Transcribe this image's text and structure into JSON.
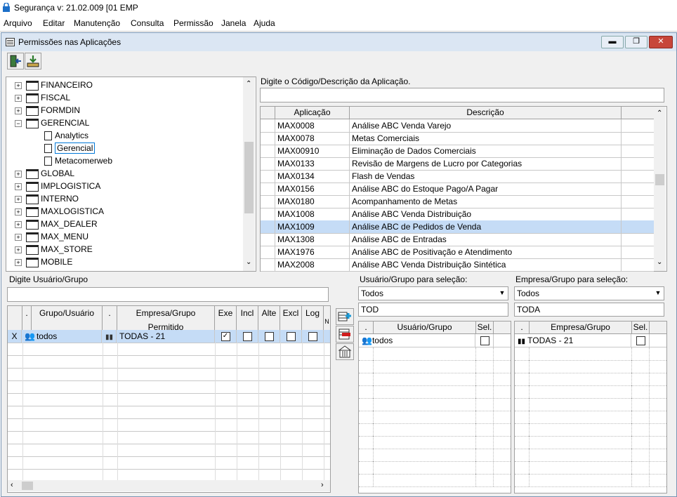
{
  "app": {
    "title": "Segurança  v: 21.02.009  [01 EMP"
  },
  "menu": [
    "Arquivo",
    "Editar",
    "Manutenção",
    "Consulta",
    "Permissão",
    "Janela",
    "Ajuda"
  ],
  "window": {
    "title": "Permissões nas Aplicações"
  },
  "tree": {
    "items": [
      {
        "label": "FINANCEIRO",
        "type": "folder",
        "expanded": false
      },
      {
        "label": "FISCAL",
        "type": "folder",
        "expanded": false
      },
      {
        "label": "FORMDIN",
        "type": "folder",
        "expanded": false
      },
      {
        "label": "GERENCIAL",
        "type": "folder",
        "expanded": true
      },
      {
        "label": "Analytics",
        "type": "doc"
      },
      {
        "label": "Gerencial",
        "type": "doc",
        "selected": true
      },
      {
        "label": "Metacomerweb",
        "type": "doc"
      },
      {
        "label": "GLOBAL",
        "type": "folder",
        "expanded": false
      },
      {
        "label": "IMPLOGISTICA",
        "type": "folder",
        "expanded": false
      },
      {
        "label": "INTERNO",
        "type": "folder",
        "expanded": false
      },
      {
        "label": "MAXLOGISTICA",
        "type": "folder",
        "expanded": false
      },
      {
        "label": "MAX_DEALER",
        "type": "folder",
        "expanded": false
      },
      {
        "label": "MAX_MENU",
        "type": "folder",
        "expanded": false
      },
      {
        "label": "MAX_STORE",
        "type": "folder",
        "expanded": false
      },
      {
        "label": "MOBILE",
        "type": "folder",
        "expanded": false
      }
    ]
  },
  "app_search": {
    "label": "Digite o Código/Descrição da Aplicação.",
    "value": ""
  },
  "app_grid": {
    "headers": [
      "Aplicação",
      "Descrição"
    ],
    "rows": [
      [
        "MAX0008",
        "Análise ABC Venda Varejo"
      ],
      [
        "MAX0078",
        "Metas Comerciais"
      ],
      [
        "MAX00910",
        "Eliminação de Dados Comerciais"
      ],
      [
        "MAX0133",
        "Revisão de Margens de Lucro por Categorias"
      ],
      [
        "MAX0134",
        "Flash de Vendas"
      ],
      [
        "MAX0156",
        "Análise ABC do Estoque Pago/A Pagar"
      ],
      [
        "MAX0180",
        "Acompanhamento de Metas"
      ],
      [
        "MAX1008",
        "Análise ABC Venda Distribuição"
      ],
      [
        "MAX1009",
        "Análise ABC de Pedidos de Venda"
      ],
      [
        "MAX1308",
        "Análise ABC de Entradas"
      ],
      [
        "MAX1976",
        "Análise ABC de Positivação e Atendimento"
      ],
      [
        "MAX2008",
        "Análise ABC Venda Distribuição Sintética"
      ]
    ],
    "selected_index": 8
  },
  "user_search": {
    "label": "Digite Usuário/Grupo",
    "value": ""
  },
  "perm_grid": {
    "headers": [
      ".",
      "Grupo/Usuário",
      ".",
      "Empresa/Grupo Permitido",
      "Exe",
      "Incl",
      "Alte",
      "Excl",
      "Log",
      "N"
    ],
    "row": {
      "marker": "X",
      "user": "todos",
      "company": "TODAS - 21",
      "exe": "✓"
    }
  },
  "user_select": {
    "label": "Usuário/Grupo para seleção:",
    "combo": "Todos",
    "filter": "TOD",
    "headers": [
      ".",
      "Usuário/Grupo",
      "Sel."
    ],
    "row": "todos"
  },
  "company_select": {
    "label": "Empresa/Grupo para seleção:",
    "combo": "Todos",
    "filter": "TODA",
    "headers": [
      ".",
      "Empresa/Grupo",
      "Sel."
    ],
    "row": "TODAS - 21"
  }
}
